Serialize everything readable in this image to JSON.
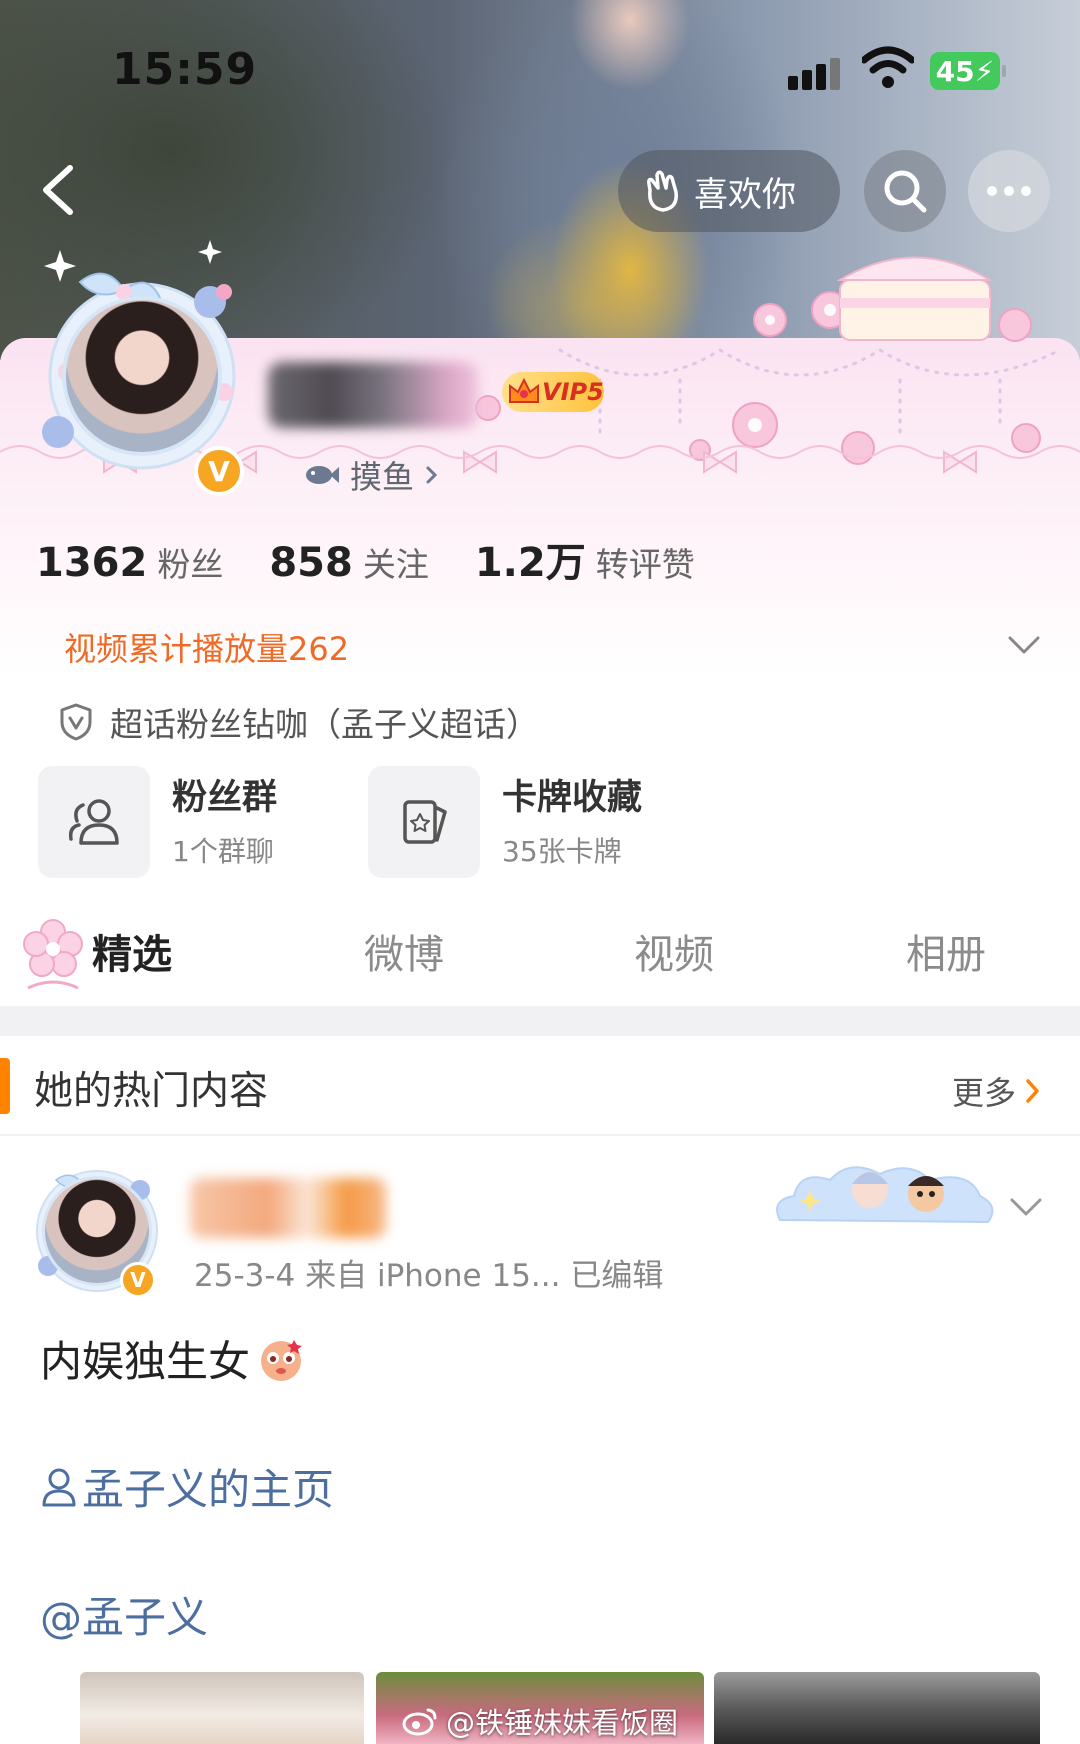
{
  "status_bar": {
    "time": "15:59",
    "battery": "45"
  },
  "header": {
    "like_label": "喜欢你"
  },
  "profile": {
    "vip_label": "VIP5",
    "verified_mark": "V",
    "tag_label": "摸鱼",
    "stats": [
      {
        "value": "1362",
        "label": "粉丝"
      },
      {
        "value": "858",
        "label": "关注"
      },
      {
        "value": "1.2万",
        "label": "转评赞"
      }
    ],
    "video_plays": "视频累计播放量262",
    "supertopic": "超话粉丝钻咖（孟子义超话）",
    "tiles": [
      {
        "title": "粉丝群",
        "subtitle": "1个群聊",
        "icon": "group-icon"
      },
      {
        "title": "卡牌收藏",
        "subtitle": "35张卡牌",
        "icon": "card-icon"
      }
    ]
  },
  "tabs": [
    {
      "label": "精选",
      "active": true
    },
    {
      "label": "微博",
      "active": false
    },
    {
      "label": "视频",
      "active": false
    },
    {
      "label": "相册",
      "active": false
    }
  ],
  "hot_section": {
    "title": "她的热门内容",
    "more_label": "更多"
  },
  "post": {
    "meta": "25-3-4  来自 iPhone 15...  已编辑",
    "text": "内娱独生女",
    "homepage_link": "孟子义的主页",
    "mention": "@孟子义",
    "watermark": "@铁锤妹妹看饭圈"
  },
  "colors": {
    "accent_orange": "#ff8200",
    "video_text": "#ef6a24",
    "link_blue": "#4d6fa0",
    "vip_gold": "#ffc23d",
    "verified": "#f6a623",
    "battery_green": "#43c95c"
  }
}
